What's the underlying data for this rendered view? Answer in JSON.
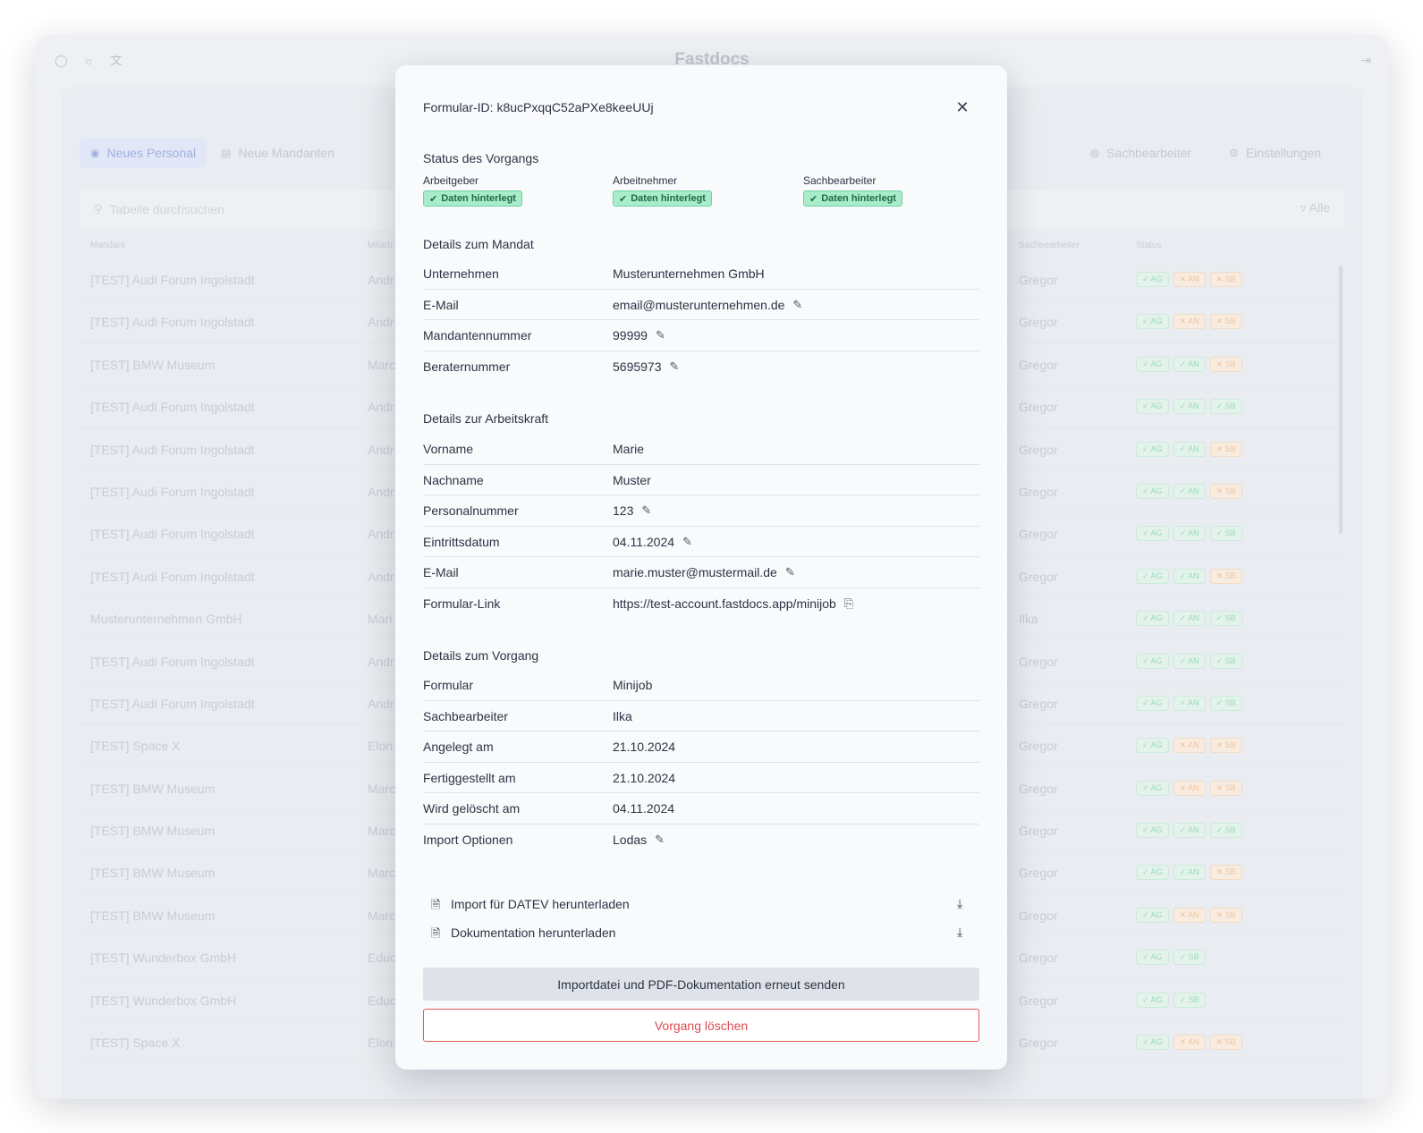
{
  "app": {
    "brand": "Fastdocs",
    "tabs": [
      {
        "label": "Neues Personal",
        "icon": "user-plus-icon"
      },
      {
        "label": "Neue Mandanten",
        "icon": "building-icon"
      }
    ],
    "right_tabs": [
      {
        "label": "Sachbearbeiter",
        "icon": "users-icon"
      },
      {
        "label": "Einstellungen",
        "icon": "gear-icon"
      }
    ],
    "search_placeholder": "Tabelle durchsuchen",
    "filter_label": "Alle",
    "columns": {
      "mandant": "Mandant",
      "mitarbeiter": "Mitarb",
      "sachbearbeiter": "Sachbearbeiter",
      "status": "Status"
    },
    "rows": [
      {
        "mandant": "[TEST] Audi Forum Ingolstadt",
        "ma": "Andr",
        "sb": "Gregor",
        "status": [
          "AG:ok",
          "AN:no",
          "SB:no"
        ]
      },
      {
        "mandant": "[TEST] Audi Forum Ingolstadt",
        "ma": "Andr",
        "sb": "Gregor",
        "status": [
          "AG:ok",
          "AN:no",
          "SB:no"
        ]
      },
      {
        "mandant": "[TEST] BMW Museum",
        "ma": "Marc",
        "sb": "Gregor",
        "status": [
          "AG:ok",
          "AN:ok",
          "SB:no"
        ]
      },
      {
        "mandant": "[TEST] Audi Forum Ingolstadt",
        "ma": "Andr",
        "sb": "Gregor",
        "status": [
          "AG:ok",
          "AN:ok",
          "SB:ok"
        ]
      },
      {
        "mandant": "[TEST] Audi Forum Ingolstadt",
        "ma": "Andr",
        "sb": "Gregor",
        "status": [
          "AG:ok",
          "AN:ok",
          "SB:no"
        ]
      },
      {
        "mandant": "[TEST] Audi Forum Ingolstadt",
        "ma": "Andr",
        "sb": "Gregor",
        "status": [
          "AG:ok",
          "AN:ok",
          "SB:no"
        ]
      },
      {
        "mandant": "[TEST] Audi Forum Ingolstadt",
        "ma": "Andr",
        "sb": "Gregor",
        "status": [
          "AG:ok",
          "AN:ok",
          "SB:ok"
        ]
      },
      {
        "mandant": "[TEST] Audi Forum Ingolstadt",
        "ma": "Andr",
        "sb": "Gregor",
        "status": [
          "AG:ok",
          "AN:ok",
          "SB:no"
        ]
      },
      {
        "mandant": "Musterunternehmen GmbH",
        "ma": "Mari",
        "sb": "Ilka",
        "status": [
          "AG:ok",
          "AN:ok",
          "SB:ok"
        ]
      },
      {
        "mandant": "[TEST] Audi Forum Ingolstadt",
        "ma": "Andr",
        "sb": "Gregor",
        "status": [
          "AG:ok",
          "AN:ok",
          "SB:ok"
        ]
      },
      {
        "mandant": "[TEST] Audi Forum Ingolstadt",
        "ma": "Andr",
        "sb": "Gregor",
        "status": [
          "AG:ok",
          "AN:ok",
          "SB:ok"
        ]
      },
      {
        "mandant": "[TEST] Space X",
        "ma": "Elon",
        "sb": "Gregor",
        "status": [
          "AG:ok",
          "AN:no",
          "SB:no"
        ]
      },
      {
        "mandant": "[TEST] BMW Museum",
        "ma": "Marc",
        "sb": "Gregor",
        "status": [
          "AG:ok",
          "AN:no",
          "SB:no"
        ]
      },
      {
        "mandant": "[TEST] BMW Museum",
        "ma": "Marc",
        "sb": "Gregor",
        "status": [
          "AG:ok",
          "AN:ok",
          "SB:ok"
        ]
      },
      {
        "mandant": "[TEST] BMW Museum",
        "ma": "Marc",
        "sb": "Gregor",
        "status": [
          "AG:ok",
          "AN:ok",
          "SB:no"
        ]
      },
      {
        "mandant": "[TEST] BMW Museum",
        "ma": "Marc",
        "sb": "Gregor",
        "status": [
          "AG:ok",
          "AN:no",
          "SB:no"
        ]
      },
      {
        "mandant": "[TEST] Wunderbox GmbH",
        "ma": "Educ",
        "sb": "Gregor",
        "status": [
          "AG:ok",
          "SB:ok"
        ]
      },
      {
        "mandant": "[TEST] Wunderbox GmbH",
        "ma": "Educ",
        "sb": "Gregor",
        "status": [
          "AG:ok",
          "SB:ok"
        ]
      },
      {
        "mandant": "[TEST] Space X",
        "ma": "Elon",
        "sb": "Gregor",
        "status": [
          "AG:ok",
          "AN:no",
          "SB:no"
        ]
      }
    ]
  },
  "modal": {
    "title": "Formular-ID: k8ucPxqqC52aPXe8keeUUj",
    "status_section": "Status des Vorgangs",
    "status": [
      {
        "label": "Arbeitgeber",
        "badge": "Daten hinterlegt"
      },
      {
        "label": "Arbeitnehmer",
        "badge": "Daten hinterlegt"
      },
      {
        "label": "Sachbearbeiter",
        "badge": "Daten hinterlegt"
      }
    ],
    "mandat_section": "Details zum Mandat",
    "mandat": [
      {
        "key": "Unternehmen",
        "value": "Musterunternehmen GmbH",
        "action": ""
      },
      {
        "key": "E-Mail",
        "value": "email@musterunternehmen.de",
        "action": "edit"
      },
      {
        "key": "Mandantennummer",
        "value": "99999",
        "action": "edit"
      },
      {
        "key": "Beraternummer",
        "value": "5695973",
        "action": "edit"
      }
    ],
    "arbeitskraft_section": "Details zur Arbeitskraft",
    "arbeitskraft": [
      {
        "key": "Vorname",
        "value": "Marie",
        "action": ""
      },
      {
        "key": "Nachname",
        "value": "Muster",
        "action": ""
      },
      {
        "key": "Personalnummer",
        "value": "123",
        "action": "edit"
      },
      {
        "key": "Eintrittsdatum",
        "value": "04.11.2024",
        "action": "edit"
      },
      {
        "key": "E-Mail",
        "value": "marie.muster@mustermail.de",
        "action": "edit"
      },
      {
        "key": "Formular-Link",
        "value": "https://test-account.fastdocs.app/minijob",
        "action": "copy"
      }
    ],
    "vorgang_section": "Details zum Vorgang",
    "vorgang": [
      {
        "key": "Formular",
        "value": "Minijob",
        "action": ""
      },
      {
        "key": "Sachbearbeiter",
        "value": "Ilka",
        "action": ""
      },
      {
        "key": "Angelegt am",
        "value": "21.10.2024",
        "action": ""
      },
      {
        "key": "Fertiggestellt am",
        "value": "21.10.2024",
        "action": ""
      },
      {
        "key": "Wird gelöscht am",
        "value": "04.11.2024",
        "action": ""
      },
      {
        "key": "Import Optionen",
        "value": "Lodas",
        "action": "edit"
      }
    ],
    "downloads": [
      {
        "label": "Import für DATEV herunterladen",
        "icon": "file-text-icon"
      },
      {
        "label": "Dokumentation herunterladen",
        "icon": "file-pdf-icon"
      }
    ],
    "resend_label": "Importdatei und PDF-Dokumentation erneut senden",
    "delete_label": "Vorgang löschen"
  }
}
